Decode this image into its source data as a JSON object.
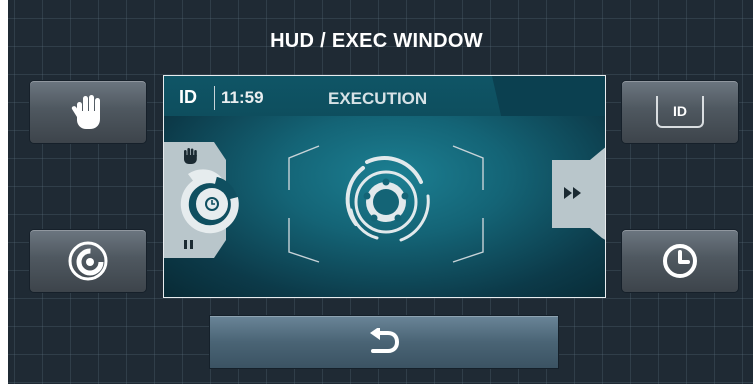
{
  "window": {
    "title": "HUD / EXEC WINDOW"
  },
  "left_buttons": [
    {
      "icon": "hand-icon",
      "action": "stop"
    },
    {
      "icon": "program-dial-icon",
      "action": "program"
    }
  ],
  "right_buttons": [
    {
      "icon": "id-icon",
      "label": "ID"
    },
    {
      "icon": "clock-icon"
    }
  ],
  "screen": {
    "header": {
      "id_label": "ID",
      "time": "11:59",
      "status": "EXECUTION"
    },
    "left_dial_icons": [
      "hand-icon",
      "clock-icon",
      "pause-icon"
    ],
    "center_icon": "drum-rotation-icon",
    "right_icon": "fast-forward-icon"
  },
  "bottom_button": {
    "icon": "back-arrow-icon"
  },
  "colors": {
    "background": "#1f2a34",
    "screen": "#146476",
    "button": "#4f5860",
    "accent": "#ffffff"
  }
}
